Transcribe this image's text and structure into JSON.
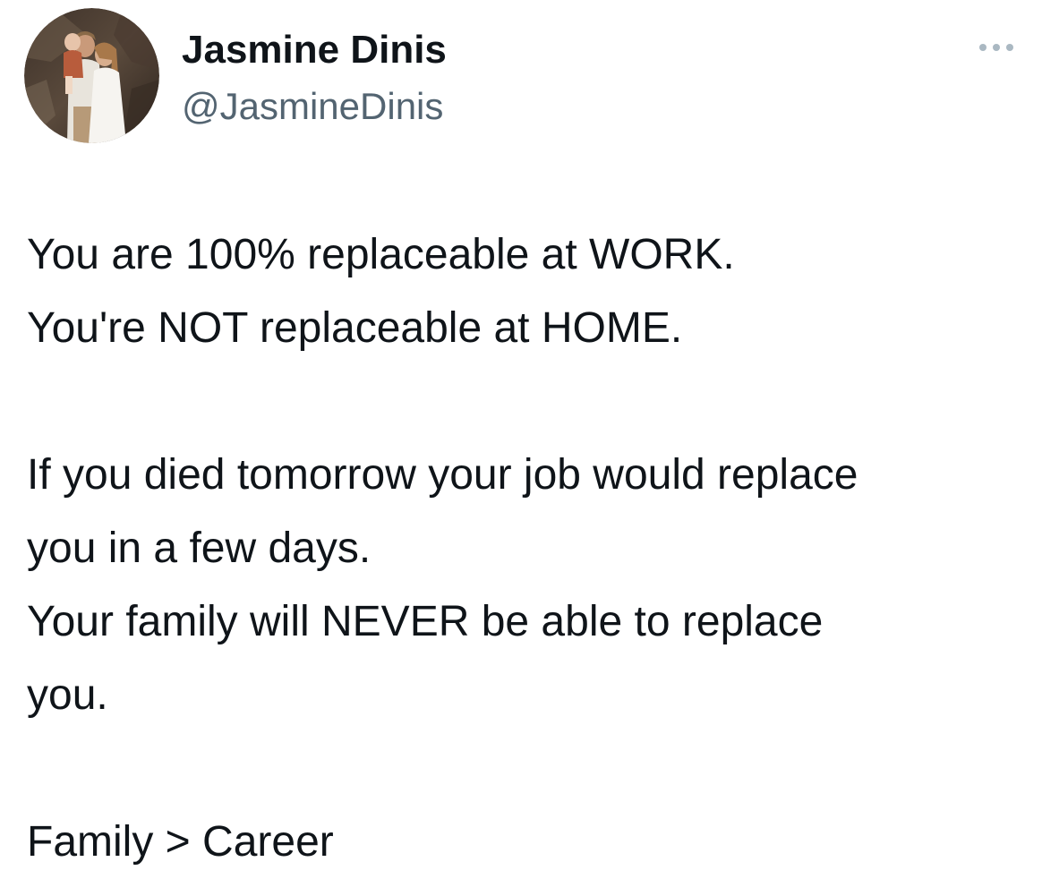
{
  "author": {
    "display_name": "Jasmine Dinis",
    "handle": "@JasmineDinis",
    "avatar_icon": "family-photo-avatar"
  },
  "actions": {
    "more_icon": "more-horizontal-icon"
  },
  "tweet": {
    "lines": [
      "You are 100% replaceable at WORK.",
      "You're NOT replaceable at HOME.",
      "",
      "If you died tomorrow your job would replace",
      "you in a few days.",
      "Your family will NEVER be able to replace",
      "you.",
      "",
      "Family > Career"
    ]
  },
  "colors": {
    "text": "#0f1419",
    "secondary_text": "#536471",
    "background": "#ffffff"
  }
}
